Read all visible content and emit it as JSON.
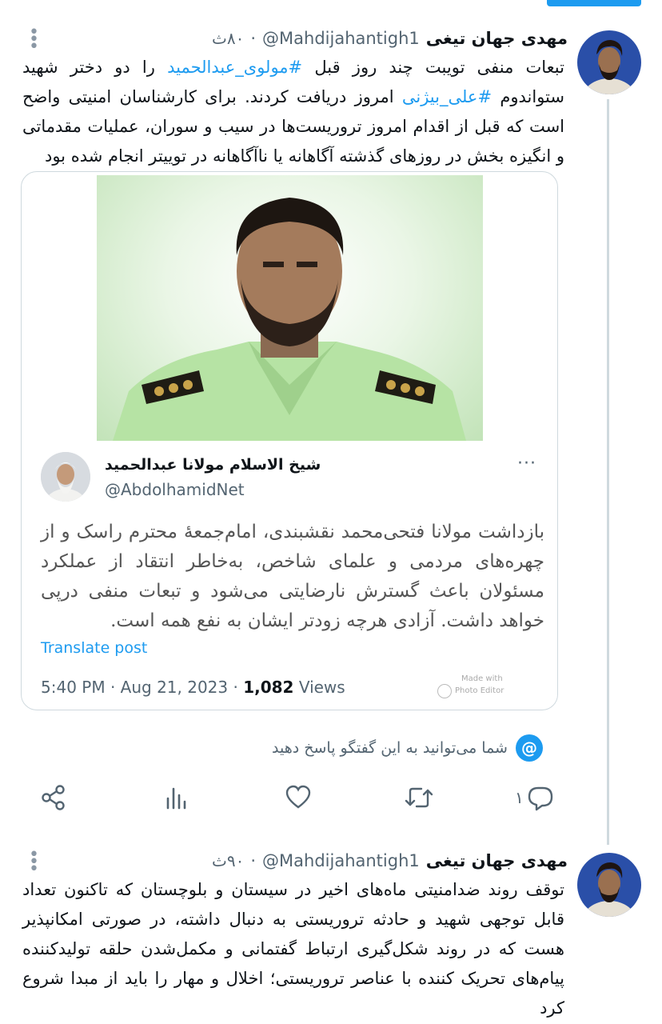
{
  "tweet1": {
    "author_name": "مهدی جهان تیغی",
    "handle": "@Mahdijahantigh1",
    "time": "۸۰ث",
    "body_parts": [
      "تبعات منفی تویبت چند روز قبل ",
      "#مولوی_عبدالحمید",
      " را دو دختر شهید ستواندوم ",
      "#علی_بیژنی",
      " امروز دریافت کردند. برای کارشناسان امنیتی واضح است که قبل از اقدام امروز تروریست‌ها در سیب و سوران، عملیات مقدماتی و انگیزه بخش در روزهای گذشته آگاهانه یا ناآگاهانه در توییتر انجام شده بود"
    ]
  },
  "quoted": {
    "author_name": "شیخ الاسلام مولانا عبدالحمید",
    "handle": "@AbdolhamidNet",
    "more": "···",
    "text": "بازداشت مولانا فتحی‌محمد نقشبندی، امام‌جمعۀ محترم راسک و از چهره‌های مردمی و علمای شاخص، به‌خاطر انتقاد از عملکرد مسئولان باعث گسترش نارضایتی می‌شود و تبعات منفی درپی خواهد داشت. آزادی هرچه زودتر ایشان به نفع همه است.",
    "translate_label": "Translate post",
    "time_date": "5:40 PM · Aug 21, 2023 · ",
    "views_count": "1,082",
    "views_label": " Views",
    "watermark": [
      "Made with",
      "Photo Editor"
    ]
  },
  "reply_notice": "شما می‌توانید به این گفتگو پاسخ دهید",
  "actions": {
    "reply_count": "۱",
    "share_icon": "share-icon",
    "analytics_icon": "analytics-icon",
    "like_icon": "heart-icon",
    "retweet_icon": "retweet-icon",
    "reply_icon": "reply-icon"
  },
  "tweet2": {
    "author_name": "مهدی جهان تیغی",
    "handle": "@Mahdijahantigh1",
    "time": "۹۰ث",
    "body": "توقف روند ضدامنیتی ماه‌های اخیر در سیستان و بلوچستان که تاکنون تعداد قابل توجهی شهید و حادثه تروریستی به دنبال داشته، در صورتی امکانپذیر هست که در روند شکل‌گیری ارتباط گفتمانی و مکمل‌شدن حلقه تولیدکننده پیام‌های تحریک کننده با عناصر تروریستی؛ اخلال و مهار را باید از مبدا شروع کرد"
  },
  "colors": {
    "accent": "#1d9bf0",
    "secondary_text": "#536471",
    "border": "#cfd9de"
  }
}
